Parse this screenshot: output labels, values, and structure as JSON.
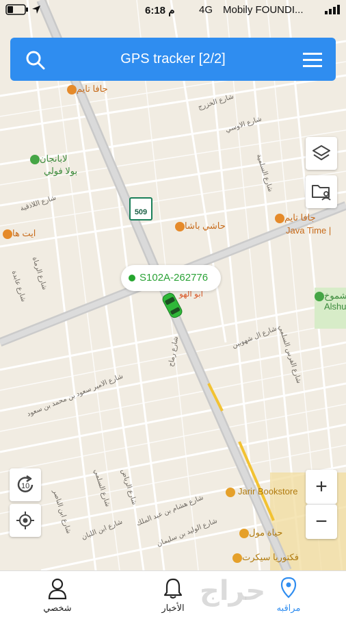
{
  "status_bar": {
    "carrier": "Mobily FOUNDI...",
    "network": "4G",
    "time": "6:18 م"
  },
  "header": {
    "title": "GPS tracker [2/2]"
  },
  "map": {
    "route_shield": "509",
    "vehicle_label": "S102A-262776",
    "pois": [
      {
        "name": "جافا تايم",
        "color": "#e58a2a"
      },
      {
        "name": "لابانجان",
        "color": "#45a545"
      },
      {
        "name": "بولا فولي",
        "color": "#45a545"
      },
      {
        "name": "ايت ها",
        "color": "#e58a2a"
      },
      {
        "name": "حاشي باشا",
        "color": "#e58a2a"
      },
      {
        "name": "جافا تايم",
        "color": "#e58a2a"
      },
      {
        "name": "Java Time |",
        "color": "#e58a2a"
      },
      {
        "name": "Alshu",
        "color": "#45a545"
      },
      {
        "name": "شموخ",
        "color": "#45a545"
      },
      {
        "name": "Jarir Bookstore",
        "color": "#e5a02a"
      },
      {
        "name": "حياة مول",
        "color": "#e5a02a"
      },
      {
        "name": "فكتوريا سيكرت",
        "color": "#e5a02a"
      },
      {
        "name": "ابو الهو",
        "color": "#d85a2a"
      }
    ],
    "streets": [
      "شارع الخزرج",
      "شارع الاوسي",
      "شارع السلمية",
      "شارع اللاذقية",
      "شارع الرماة",
      "شارع عابدة",
      "شارع رماح",
      "شارع الامير سعود بن محمد بن سعود",
      "شارع السلمي",
      "شارع الرياض",
      "شارع ابن الناصر",
      "شارع هشام بن عبد الملك",
      "شارع ابن اللبان",
      "شارع الوليد بن سليمان",
      "شارع الفرس السلمي",
      "شارع ال شهوبين"
    ]
  },
  "controls": {
    "layers": "layers-icon",
    "geofence": "folder-user-icon",
    "refresh_label": "10",
    "zoom_in": "+",
    "zoom_out": "−"
  },
  "tabs": [
    {
      "label": "شخصي",
      "icon": "person-icon"
    },
    {
      "label": "الأخبار",
      "icon": "bell-icon"
    },
    {
      "label": "مراقبه",
      "icon": "location-pin-icon"
    }
  ],
  "watermark": "حراج",
  "colors": {
    "accent": "#2f8df0",
    "vehicle": "#27a832",
    "tab_active": "#2f8df0"
  }
}
